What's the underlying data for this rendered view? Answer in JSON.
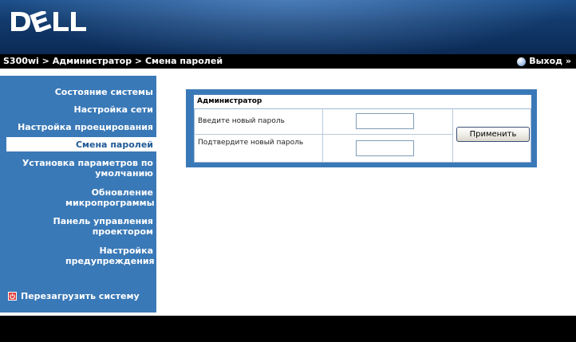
{
  "header": {
    "logo_icon": "dell-logo-icon",
    "logo_text": "DELL"
  },
  "breadcrumb": {
    "text": "S300wi > Администратор > Смена паролей"
  },
  "logout": {
    "label": "Выход »",
    "icon": "globe-icon"
  },
  "sidebar": {
    "items": [
      {
        "label": "Состояние системы",
        "active": false
      },
      {
        "label": "Настройка сети",
        "active": false
      },
      {
        "label": "Настройка проецирования",
        "active": false
      },
      {
        "label": "Смена паролей",
        "active": true
      },
      {
        "label": "Установка параметров по умолчанию",
        "active": false
      },
      {
        "label": "Обновление микропрограммы",
        "active": false
      },
      {
        "label": "Панель управления проектором",
        "active": false
      },
      {
        "label": "Настройка предупреждения",
        "active": false
      }
    ],
    "reboot_label": "Перезагрузить систему",
    "reboot_icon": "power-icon"
  },
  "admin_panel": {
    "title": "Администратор",
    "new_password_label": "Введите новый пароль",
    "new_password_value": "",
    "confirm_password_label": "Подтвердите новый пароль",
    "confirm_password_value": "",
    "apply_label": "Применить"
  },
  "colors": {
    "header": "#123a6b",
    "sidebar": "#3a79b7",
    "active_text": "#1f5a96",
    "bar": "#000000",
    "reboot_icon": "#e0413e"
  }
}
